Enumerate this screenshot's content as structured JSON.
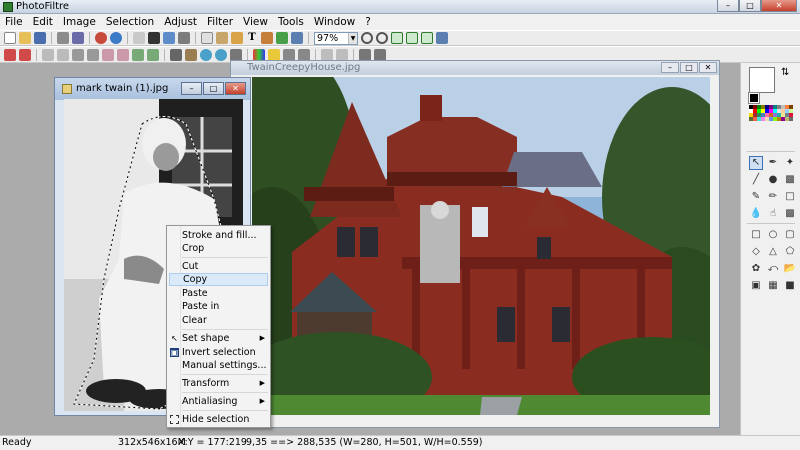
{
  "app": {
    "title": "PhotoFiltre"
  },
  "menu": [
    "File",
    "Edit",
    "Image",
    "Selection",
    "Adjust",
    "Filter",
    "View",
    "Tools",
    "Window",
    "?"
  ],
  "toolbar": {
    "zoom_value": "97%",
    "text_tool_label": "T"
  },
  "windows": {
    "active": {
      "title": "mark twain (1).jpg"
    },
    "background": {
      "title": "TwainCreepyHouse.jpg"
    }
  },
  "context_menu": {
    "items": [
      {
        "label": "Stroke and fill...",
        "icon": "",
        "submenu": false,
        "highlighted": false
      },
      {
        "label": "Crop",
        "icon": "",
        "submenu": false,
        "highlighted": false
      },
      {
        "label": "Cut",
        "icon": "",
        "submenu": false,
        "highlighted": false
      },
      {
        "label": "Copy",
        "icon": "",
        "submenu": false,
        "highlighted": true
      },
      {
        "label": "Paste",
        "icon": "",
        "submenu": false,
        "highlighted": false
      },
      {
        "label": "Paste in",
        "icon": "",
        "submenu": false,
        "highlighted": false
      },
      {
        "label": "Clear",
        "icon": "",
        "submenu": false,
        "highlighted": false
      },
      {
        "label": "Set shape",
        "icon": "cursor-icon",
        "submenu": true,
        "highlighted": false
      },
      {
        "label": "Invert selection",
        "icon": "invert-icon",
        "submenu": false,
        "highlighted": false
      },
      {
        "label": "Manual settings...",
        "icon": "",
        "submenu": false,
        "highlighted": false
      },
      {
        "label": "Transform",
        "icon": "",
        "submenu": true,
        "highlighted": false
      },
      {
        "label": "Antialiasing",
        "icon": "",
        "submenu": true,
        "highlighted": false
      },
      {
        "label": "Hide selection",
        "icon": "hide-selection-icon",
        "submenu": false,
        "highlighted": false
      }
    ]
  },
  "status": {
    "ready": "Ready",
    "image_info": "312x546x16M",
    "cursor": "X:Y = 177:219",
    "selection": "9,35 ==> 288,535 (W=280, H=501, W/H=0.559)"
  },
  "colors": {
    "menu_highlight": "#dbeaf9",
    "title_close": "#c4412b",
    "workspace": "#ababab"
  }
}
